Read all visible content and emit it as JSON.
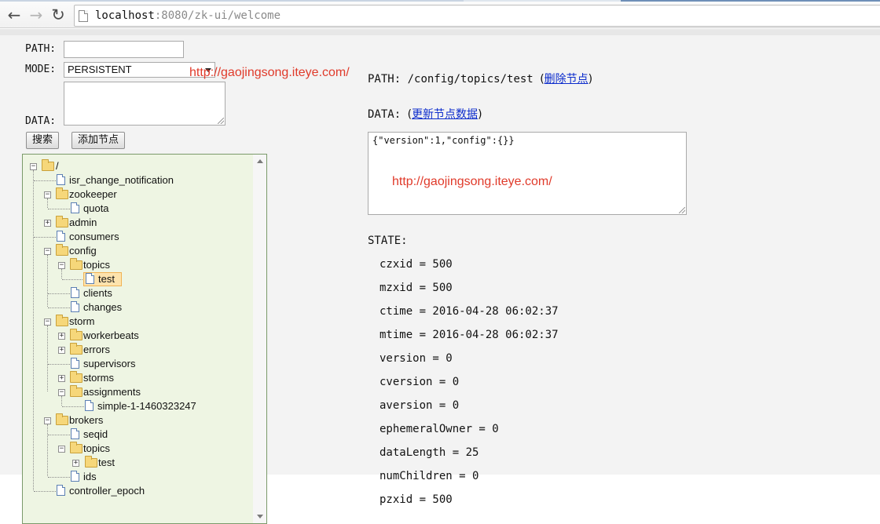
{
  "browser": {
    "url_host": "localhost",
    "url_rest": ":8080/zk-ui/welcome"
  },
  "form": {
    "path_label": "PATH:",
    "path_value": "",
    "mode_label": "MODE:",
    "mode_value": "PERSISTENT",
    "data_label": "DATA:",
    "data_value": "",
    "search_button": "搜索",
    "add_button": "添加节点"
  },
  "watermark": "http://gaojingsong.iteye.com/",
  "tree": {
    "root": "/",
    "nodes": [
      "isr_change_notification",
      "zookeeper",
      "quota",
      "admin",
      "consumers",
      "config",
      "topics",
      "test",
      "clients",
      "changes",
      "storm",
      "workerbeats",
      "errors",
      "supervisors",
      "storms",
      "assignments",
      "simple-1-1460323247",
      "brokers",
      "seqid",
      "topics",
      "test",
      "ids",
      "controller_epoch"
    ]
  },
  "detail": {
    "path_label": "PATH:",
    "path_value": "/config/topics/test",
    "delete_link": "删除节点",
    "data_label": "DATA:",
    "update_link": "更新节点数据",
    "data_value": "{\"version\":1,\"config\":{}}",
    "state_label": "STATE:",
    "state": [
      "czxid = 500",
      "mzxid = 500",
      "ctime = 2016-04-28 06:02:37",
      "mtime = 2016-04-28 06:02:37",
      "version = 0",
      "cversion = 0",
      "aversion = 0",
      "ephemeralOwner = 0",
      "dataLength = 25",
      "numChildren = 0",
      "pzxid = 500"
    ]
  }
}
